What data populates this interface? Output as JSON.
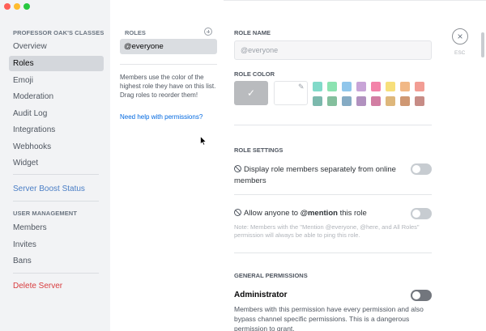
{
  "sidebar": {
    "heading": "PROFESSOR OAK'S CLASSES",
    "items": [
      {
        "label": "Overview"
      },
      {
        "label": "Roles"
      },
      {
        "label": "Emoji"
      },
      {
        "label": "Moderation"
      },
      {
        "label": "Audit Log"
      },
      {
        "label": "Integrations"
      },
      {
        "label": "Webhooks"
      },
      {
        "label": "Widget"
      }
    ],
    "boost": "Server Boost Status",
    "user_mgmt_heading": "USER MANAGEMENT",
    "user_items": [
      {
        "label": "Members"
      },
      {
        "label": "Invites"
      },
      {
        "label": "Bans"
      }
    ],
    "delete": "Delete Server"
  },
  "roles": {
    "title": "ROLES",
    "everyone": "@everyone",
    "help": "Members use the color of the highest role they have on this list. Drag roles to reorder them!",
    "link": "Need help with permissions?"
  },
  "main": {
    "role_name_label": "ROLE NAME",
    "role_name_value": "@everyone",
    "role_color_label": "ROLE COLOR",
    "swatches": [
      "#1abc9c",
      "#2ecc71",
      "#3498db",
      "#9b59b6",
      "#e91e63",
      "#f1c40f",
      "#e67e22",
      "#e74c3c",
      "#11806a",
      "#1f8b4c",
      "#206694",
      "#71368a",
      "#ad1457",
      "#c27c0e",
      "#a84300",
      "#992d22"
    ],
    "role_settings_label": "ROLE SETTINGS",
    "setting1": "Display role members separately from online members",
    "setting2_prefix": "Allow anyone to ",
    "setting2_mention": "@mention",
    "setting2_suffix": " this role",
    "setting2_note": "Note: Members with the \"Mention @everyone, @here, and All Roles\" permission will always be able to ping this role.",
    "general_label": "GENERAL PERMISSIONS",
    "admin_title": "Administrator",
    "admin_desc": "Members with this permission have every permission and also bypass channel specific permissions. This is a dangerous permission to grant."
  },
  "close": {
    "icon": "×",
    "label": "ESC"
  }
}
